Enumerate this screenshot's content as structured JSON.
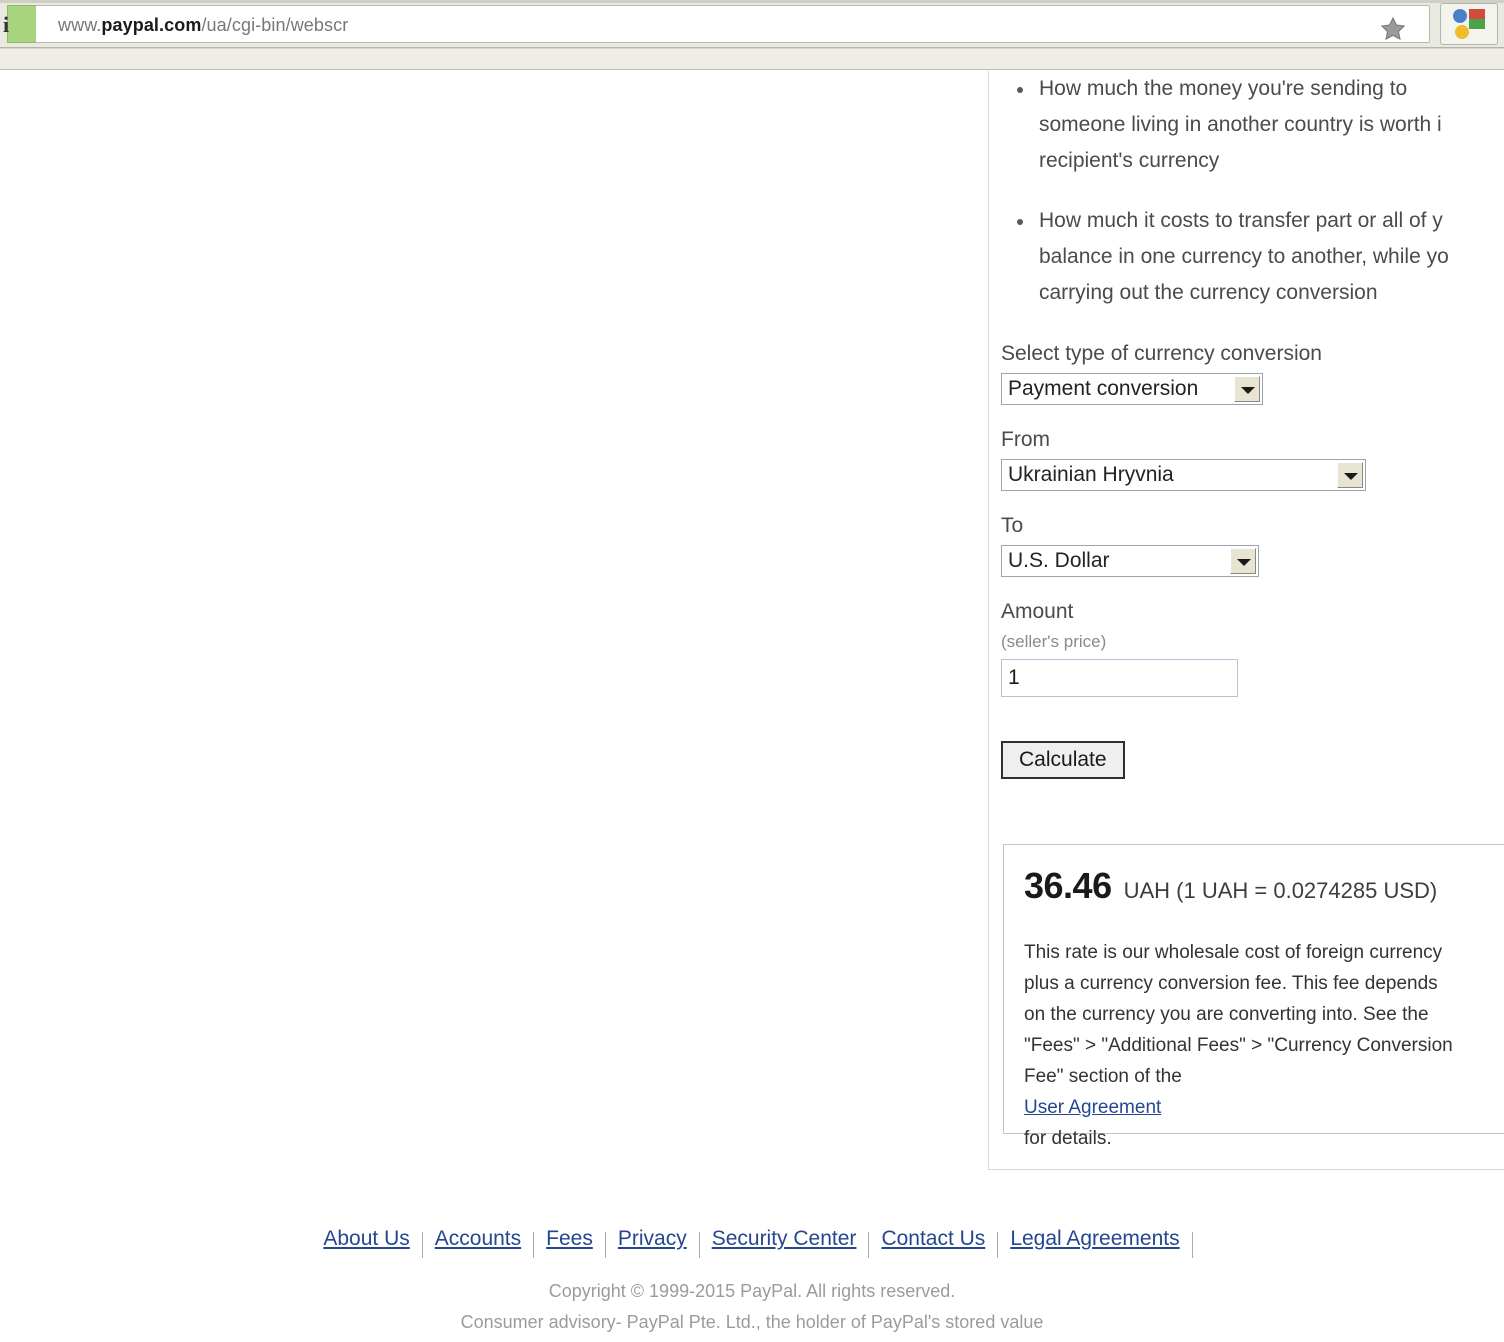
{
  "browser": {
    "url_prefix": "www.",
    "url_domain": "paypal.com",
    "url_path": "/ua/cgi-bin/webscr",
    "ev_glyph": "i",
    "star_icon": "bookmark-star-icon",
    "profile_icon": "google-profile-icon"
  },
  "bullets": [
    {
      "lines": [
        "How much the money you're sending to",
        "someone living in another country is worth i",
        "recipient's currency"
      ]
    },
    {
      "lines": [
        "How much it costs to transfer part or all of y",
        "balance in one currency to another, while yo",
        "carrying out the currency conversion"
      ]
    }
  ],
  "form": {
    "type_label": "Select type of currency conversion",
    "type_value": "Payment conversion",
    "from_label": "From",
    "from_value": "Ukrainian Hryvnia",
    "to_label": "To",
    "to_value": "U.S. Dollar",
    "amount_label": "Amount",
    "amount_sublabel": "(seller's price)",
    "amount_value": "1",
    "calculate_label": "Calculate"
  },
  "result": {
    "amount": "36.46",
    "rate_text": "UAH (1 UAH = 0.0274285  USD)",
    "note_lines": [
      "This rate is our wholesale cost of foreign currency",
      "plus a currency conversion fee. This fee depends",
      "on the currency you are converting into. See the",
      "\"Fees\" > \"Additional Fees\" > \"Currency Conversion"
    ],
    "note_last_prefix": "Fee\" section of the ",
    "note_link": "User Agreement",
    "note_last_suffix": " for details."
  },
  "footer": {
    "links": [
      "About Us",
      "Accounts",
      "Fees",
      "Privacy",
      "Security Center",
      "Contact Us",
      "Legal Agreements"
    ],
    "copyright_line1": "Copyright © 1999-2015 PayPal. All rights reserved.",
    "copyright_line2": "Consumer advisory- PayPal Pte. Ltd., the holder of PayPal's stored value"
  },
  "colors": {
    "link": "#24478f",
    "chrome": "#e9e9e2",
    "ev_green": "#a8d47f",
    "result_border": "#b8c6d6"
  }
}
